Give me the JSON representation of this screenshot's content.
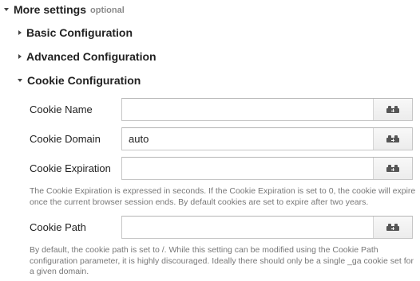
{
  "more_settings": {
    "label": "More settings",
    "optional": "optional"
  },
  "sections": {
    "basic": "Basic Configuration",
    "advanced": "Advanced Configuration",
    "cookie": "Cookie Configuration"
  },
  "fields": {
    "cookie_name": {
      "label": "Cookie Name",
      "value": ""
    },
    "cookie_domain": {
      "label": "Cookie Domain",
      "value": "auto"
    },
    "cookie_expiration": {
      "label": "Cookie Expiration",
      "value": "",
      "help": "The Cookie Expiration is expressed in seconds. If the Cookie Expiration is set to 0, the cookie will expire once the current browser session ends. By default cookies are set to expire after two years."
    },
    "cookie_path": {
      "label": "Cookie Path",
      "value": "",
      "help": "By default, the cookie path is set to /. While this setting can be modified using the Cookie Path configuration parameter, it is highly discouraged. Ideally there should only be a single _ga cookie set for a given domain."
    }
  },
  "icons": {
    "variable_button": "variable-picker-icon"
  }
}
